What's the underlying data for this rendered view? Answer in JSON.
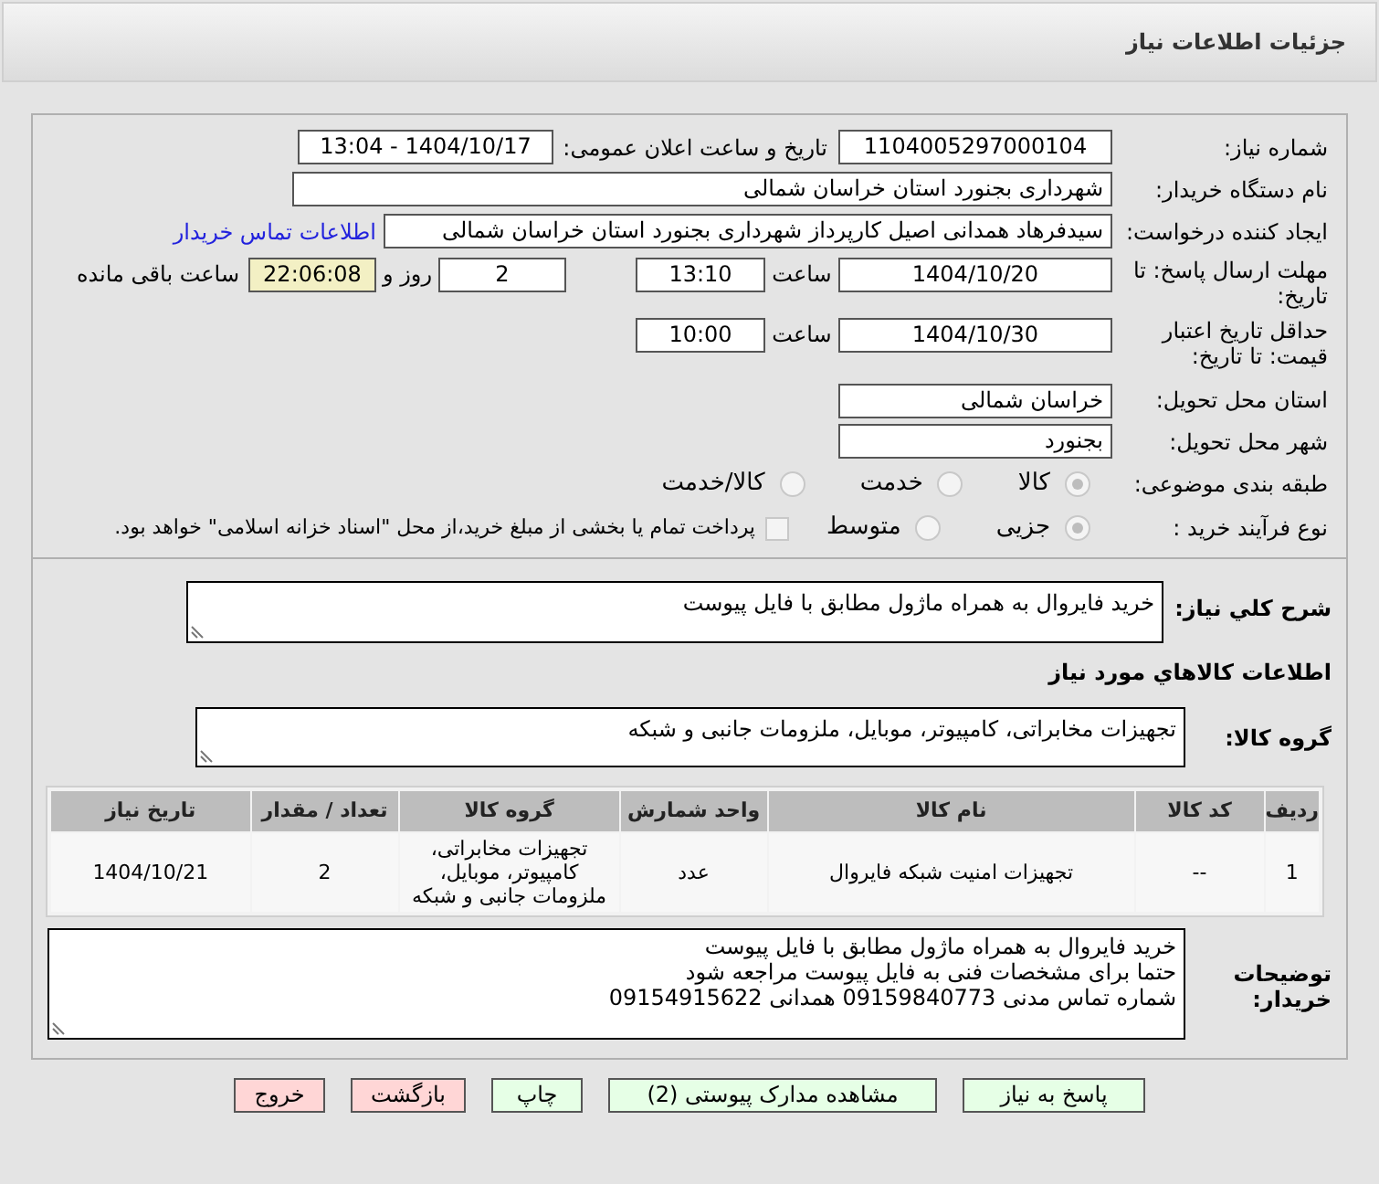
{
  "header": {
    "title": "جزئیات اطلاعات نیاز"
  },
  "need_number": {
    "label": "شماره نیاز:",
    "value": "1104005297000104"
  },
  "announce": {
    "label": "تاریخ و ساعت اعلان عمومی:",
    "value": "1404/10/17 - 13:04"
  },
  "buyer_org": {
    "label": "نام دستگاه خریدار:",
    "value": "شهرداری بجنورد استان خراسان شمالی"
  },
  "creator": {
    "label": "ایجاد کننده درخواست:",
    "value": "سیدفرهاد همدانی اصیل کارپرداز شهرداری بجنورد استان خراسان شمالی",
    "link": "اطلاعات تماس خریدار"
  },
  "deadline": {
    "label": "مهلت ارسال پاسخ: تا تاریخ:",
    "date": "1404/10/20",
    "time_label": "ساعت",
    "time": "13:10",
    "days": "2",
    "days_label": "روز و",
    "remaining": "22:06:08",
    "remaining_label": "ساعت باقی مانده"
  },
  "validity": {
    "label": "حداقل تاریخ اعتبار قیمت: تا تاریخ:",
    "date": "1404/10/30",
    "time_label": "ساعت",
    "time": "10:00"
  },
  "province": {
    "label": "استان محل تحویل:",
    "value": "خراسان شمالی"
  },
  "city": {
    "label": "شهر محل تحویل:",
    "value": "بجنورد"
  },
  "category": {
    "label": "طبقه بندی موضوعی:",
    "options": [
      {
        "label": "کالا",
        "selected": true
      },
      {
        "label": "خدمت",
        "selected": false
      },
      {
        "label": "کالا/خدمت",
        "selected": false
      }
    ]
  },
  "process": {
    "label": "نوع فرآیند خرید :",
    "options": [
      {
        "label": "جزیی",
        "selected": true
      },
      {
        "label": "متوسط",
        "selected": false
      }
    ],
    "payment_checked": false,
    "payment_text": "پرداخت تمام یا بخشی از مبلغ خرید،از محل \"اسناد خزانه اسلامی\" خواهد بود."
  },
  "description": {
    "label": "شرح کلي نياز:",
    "value": "خرید فایروال به همراه ماژول مطابق با فایل پیوست"
  },
  "goods_heading": "اطلاعات کالاهاي مورد نياز",
  "goods_group": {
    "label": "گروه کالا:",
    "value": "تجهیزات مخابراتی، کامپیوتر، موبایل، ملزومات جانبی و شبکه"
  },
  "table": {
    "columns": [
      "ردیف",
      "کد کالا",
      "نام کالا",
      "واحد شمارش",
      "گروه کالا",
      "تعداد / مقدار",
      "تاریخ نیاز"
    ],
    "rows": [
      [
        "1",
        "--",
        "تجهیزات امنیت شبکه فایروال",
        "عدد",
        "تجهیزات مخابراتی، کامپیوتر، موبایل، ملزومات جانبی و شبکه",
        "2",
        "1404/10/21"
      ]
    ]
  },
  "buyer_notes": {
    "label": "توضیحات خریدار:",
    "lines": [
      "خرید فایروال به همراه ماژول مطابق با فایل پیوست",
      "حتما برای مشخصات فنی به فایل پیوست مراجعه شود",
      "شماره تماس مدنی 09159840773 همدانی 09154915622"
    ]
  },
  "buttons": [
    {
      "label": "پاسخ به نیاز",
      "kind": "action"
    },
    {
      "label": "مشاهده مدارک پیوستی (2)",
      "kind": "action"
    },
    {
      "label": "چاپ",
      "kind": "action"
    },
    {
      "label": "بازگشت",
      "kind": "exit"
    },
    {
      "label": "خروج",
      "kind": "exit"
    }
  ]
}
